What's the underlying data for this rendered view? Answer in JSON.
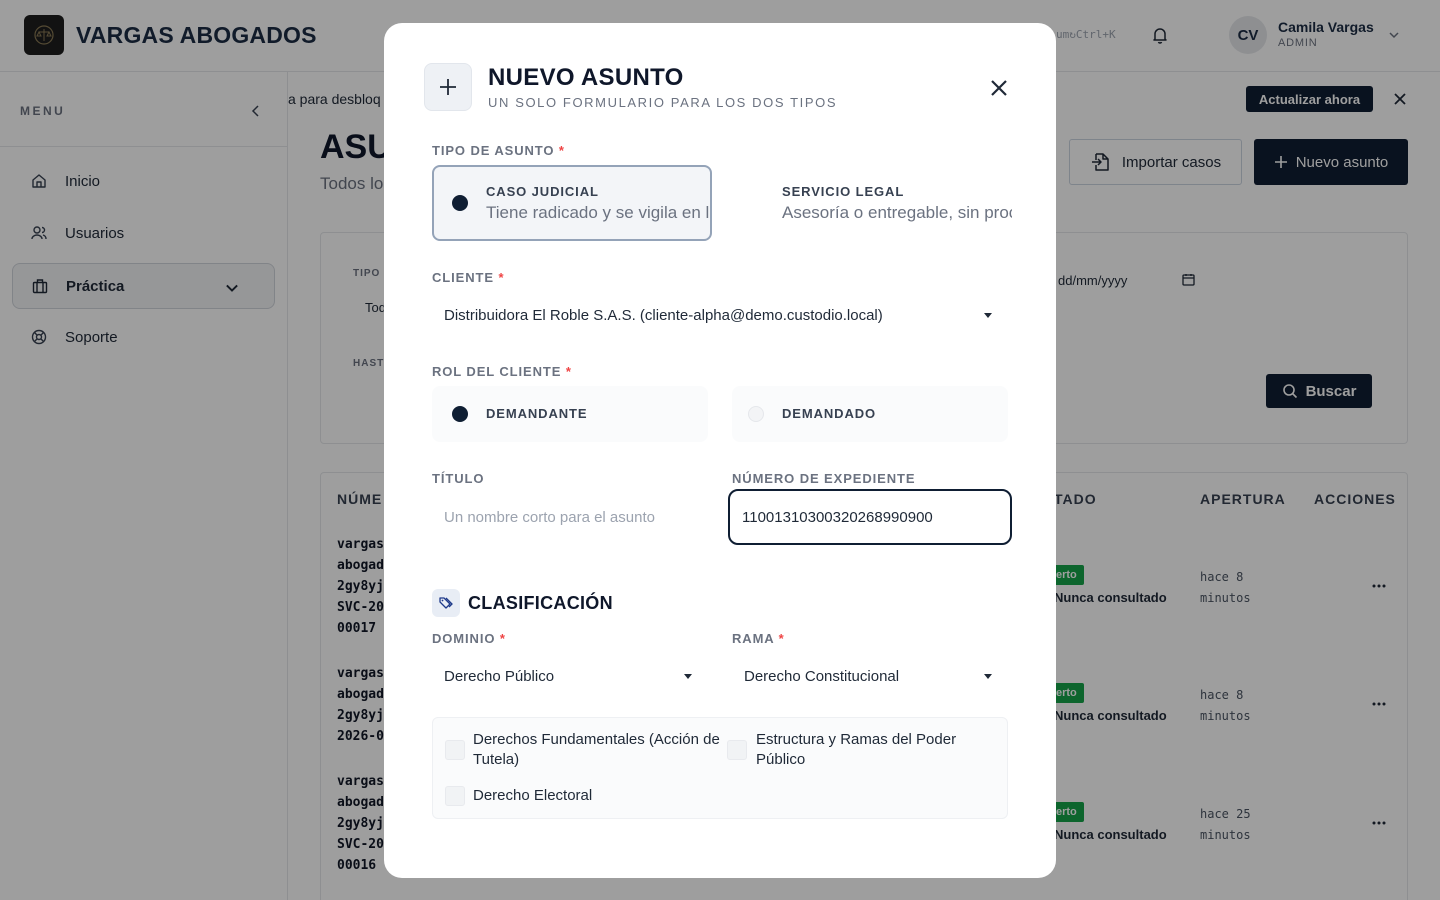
{
  "topbar": {
    "brand": "VARGAS ABOGADOS",
    "search_shortcut": "um↻Ctrl+K",
    "user": {
      "initials": "CV",
      "name": "Camila Vargas",
      "role": "ADMIN"
    }
  },
  "sidebar": {
    "menu_label": "MENU",
    "items": [
      {
        "label": "Inicio",
        "icon": "home-icon"
      },
      {
        "label": "Usuarios",
        "icon": "users-icon"
      },
      {
        "label": "Práctica",
        "icon": "briefcase-icon",
        "active": true
      },
      {
        "label": "Soporte",
        "icon": "lifebuoy-icon"
      }
    ]
  },
  "banner": {
    "text": "a para desbloq",
    "button": "Actualizar ahora"
  },
  "page": {
    "title": "ASU",
    "subtitle": "Todos lo",
    "import_button": "Importar casos",
    "new_button": "Nuevo asunto"
  },
  "filters": {
    "tipo_label": "TIPO",
    "tipo_value": "Tod",
    "hasta_label": "HAST",
    "date_placeholder": "dd/mm/yyyy",
    "search_button": "Buscar"
  },
  "table": {
    "headers": {
      "numero": "NÚME",
      "estado": "TADO",
      "apertura": "APERTURA",
      "acciones": "ACCIONES"
    },
    "rows": [
      {
        "id_lines": "vargas\nabogad\n2gy8yj\nSVC-20\n00017",
        "badge": "erto",
        "last_seen": "Nunca consultado",
        "opened": "hace 8\nminutos"
      },
      {
        "id_lines": "vargas\nabogad\n2gy8yj\n2026-0",
        "badge": "erto",
        "last_seen": "Nunca consultado",
        "opened": "hace 8\nminutos"
      },
      {
        "id_lines": "vargas\nabogad\n2gy8yj\nSVC-20\n00016",
        "badge": "erto",
        "last_seen": "Nunca consultado",
        "opened": "hace 25\nminutos"
      }
    ]
  },
  "modal": {
    "title": "NUEVO ASUNTO",
    "subtitle": "UN SOLO FORMULARIO PARA LOS DOS TIPOS",
    "tipo_label": "TIPO DE ASUNTO",
    "required_mark": "*",
    "types": [
      {
        "title": "CASO JUDICIAL",
        "description": "Tiene radicado y se vigila en la Rama Judicial.",
        "selected": true
      },
      {
        "title": "SERVICIO LEGAL",
        "description": "Asesoría o entregable, sin proceso judicial.",
        "selected": false
      }
    ],
    "cliente_label": "CLIENTE",
    "cliente_value": "Distribuidora El Roble S.A.S. (cliente-alpha@demo.custodio.local)",
    "rol_label": "ROL DEL CLIENTE",
    "roles": [
      {
        "label": "DEMANDANTE",
        "selected": true
      },
      {
        "label": "DEMANDADO",
        "selected": false
      }
    ],
    "titulo_label": "TÍTULO",
    "titulo_placeholder": "Un nombre corto para el asunto",
    "expediente_label": "NÚMERO DE EXPEDIENTE",
    "expediente_value": "11001310300320268990900",
    "clasificacion_title": "CLASIFICACIÓN",
    "dominio_label": "DOMINIO",
    "dominio_value": "Derecho Público",
    "rama_label": "RAMA",
    "rama_value": "Derecho Constitucional",
    "checkboxes": [
      {
        "label": "Derechos Fundamentales (Acción de Tutela)",
        "checked": false
      },
      {
        "label": "Estructura y Ramas del Poder Público",
        "checked": false
      },
      {
        "label": "Derecho Electoral",
        "checked": false
      }
    ]
  },
  "colors": {
    "primary": "#0f1e33",
    "required": "#ef4444",
    "success": "#16a34a",
    "overlay": "rgba(0,0,0,0.38)"
  }
}
